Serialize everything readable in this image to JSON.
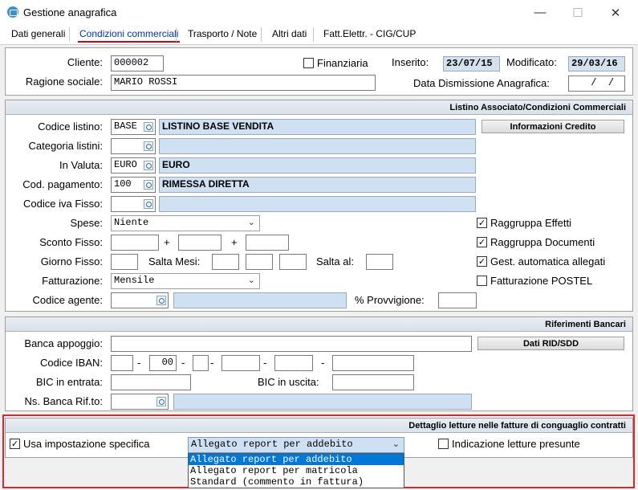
{
  "window": {
    "title": "Gestione anagrafica",
    "minimize": "—",
    "maximize": "☐",
    "close": "✕"
  },
  "tabs": [
    "Dati generali",
    "Condizioni commerciali",
    "Trasporto / Note",
    "Altri dati",
    "Fatt.Elettr. - CIG/CUP"
  ],
  "active_tab": "Condizioni commerciali",
  "cliente": {
    "cliente_label": "Cliente:",
    "cliente_value": "000002",
    "ragione_label": "Ragione sociale:",
    "ragione_value": "MARIO ROSSI",
    "finanziaria_label": "Finanziaria",
    "inserito_label": "Inserito:",
    "inserito_value": "23/07/15",
    "modificato_label": "Modificato:",
    "modificato_value": "29/03/16",
    "dismissione_label": "Data Dismissione Anagrafica:",
    "dismissione_value": "  /  /"
  },
  "listino": {
    "header": "Listino Associato/Condizioni Commerciali",
    "codice_listino_label": "Codice listino:",
    "codice_listino_value": "BASE",
    "codice_listino_desc": "LISTINO BASE VENDITA",
    "info_credito_button": "Informazioni Credito",
    "categoria_label": "Categoria listini:",
    "valuta_label": "In Valuta:",
    "valuta_value": "EURO",
    "valuta_desc": "EURO",
    "pagamento_label": "Cod. pagamento:",
    "pagamento_value": "100",
    "pagamento_desc": "RIMESSA DIRETTA",
    "iva_label": "Codice iva Fisso:",
    "spese_label": "Spese:",
    "spese_value": "Niente",
    "sconto_label": "Sconto Fisso:",
    "plus": "+",
    "giorno_label": "Giorno Fisso:",
    "salta_mesi_label": "Salta Mesi:",
    "salta_al_label": "Salta al:",
    "fatturazione_label": "Fatturazione:",
    "fatturazione_value": "Mensile",
    "agente_label": "Codice agente:",
    "provvigione_label": "% Provvigione:",
    "raggruppa_effetti": "Raggruppa Effetti",
    "raggruppa_documenti": "Raggruppa Documenti",
    "gest_allegati": "Gest. automatica allegati",
    "fatt_postel": "Fatturazione POSTEL",
    "check_mark": "✓"
  },
  "banca": {
    "header": "Riferimenti Bancari",
    "appoggio_label": "Banca appoggio:",
    "dati_rid_button": "Dati RID/SDD",
    "iban_label": "Codice IBAN:",
    "iban_dash": "-",
    "iban_check": "00",
    "bic_entrata_label": "BIC in entrata:",
    "bic_uscita_label": "BIC in uscita:",
    "ns_banca_label": "Ns. Banca Rif.to:"
  },
  "letture": {
    "header": "Dettaglio letture nelle fatture di conguaglio contratti",
    "usa_label": "Usa impostazione specifica",
    "combo_value": "Allegato report per addebito",
    "presunte_label": "Indicazione letture presunte",
    "options": [
      "Allegato report per addebito",
      "Allegato report per matricola",
      "Standard (commento in fattura)"
    ]
  },
  "colors": {
    "accent_red": "#e0262d",
    "selection_blue": "#0078d7",
    "field_blue": "#cfe0f3"
  }
}
